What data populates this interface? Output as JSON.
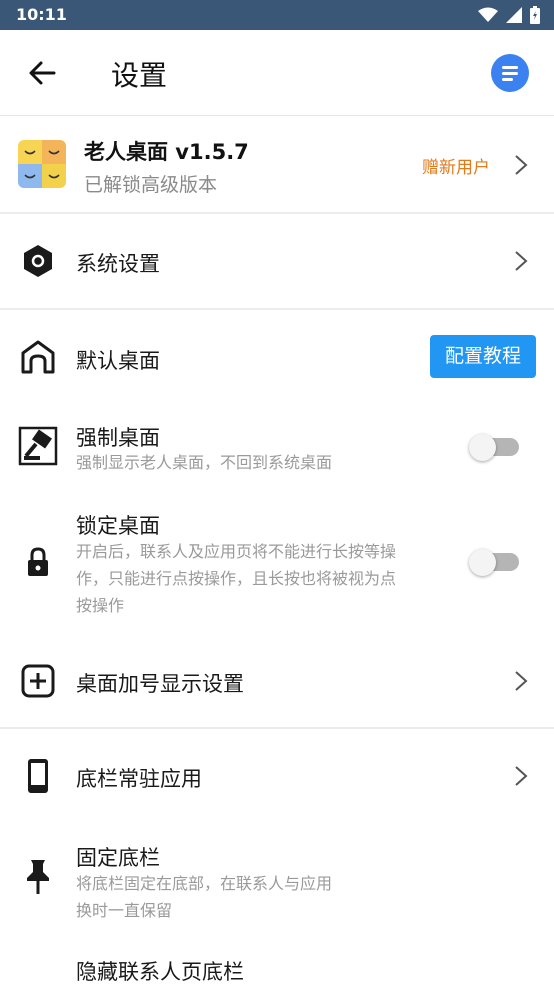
{
  "status_bar": {
    "time": "10:11"
  },
  "app_bar": {
    "title": "设置"
  },
  "app_info": {
    "name": "老人桌面 v1.5.7",
    "subtitle": "已解锁高级版本",
    "gift_label": "赠新用户"
  },
  "settings": {
    "system": {
      "label": "系统设置"
    },
    "default_desktop": {
      "label": "默认桌面",
      "button": "配置教程"
    },
    "force_desktop": {
      "label": "强制桌面",
      "desc": "强制显示老人桌面，不回到系统桌面",
      "enabled": false
    },
    "lock_desktop": {
      "label": "锁定桌面",
      "desc_line1": "开启后，联系人及应用页将不能进行长按等操",
      "desc_line2": "作，只能进行点按操作，且长按也将被视为点",
      "desc_line3": "按操作",
      "enabled": false
    },
    "plus_display": {
      "label": "桌面加号显示设置"
    },
    "dock_apps": {
      "label": "底栏常驻应用"
    },
    "fixed_dock": {
      "label": "固定底栏",
      "desc_line1": "将底栏固定在底部，在联系人与应用",
      "desc_line2": "换时一直保留"
    },
    "hide_contacts_dock": {
      "label": "隐藏联系人页底栏"
    }
  },
  "colors": {
    "status_bar": "#3a5778",
    "accent": "#2196f3",
    "gift": "#e27a1b"
  }
}
